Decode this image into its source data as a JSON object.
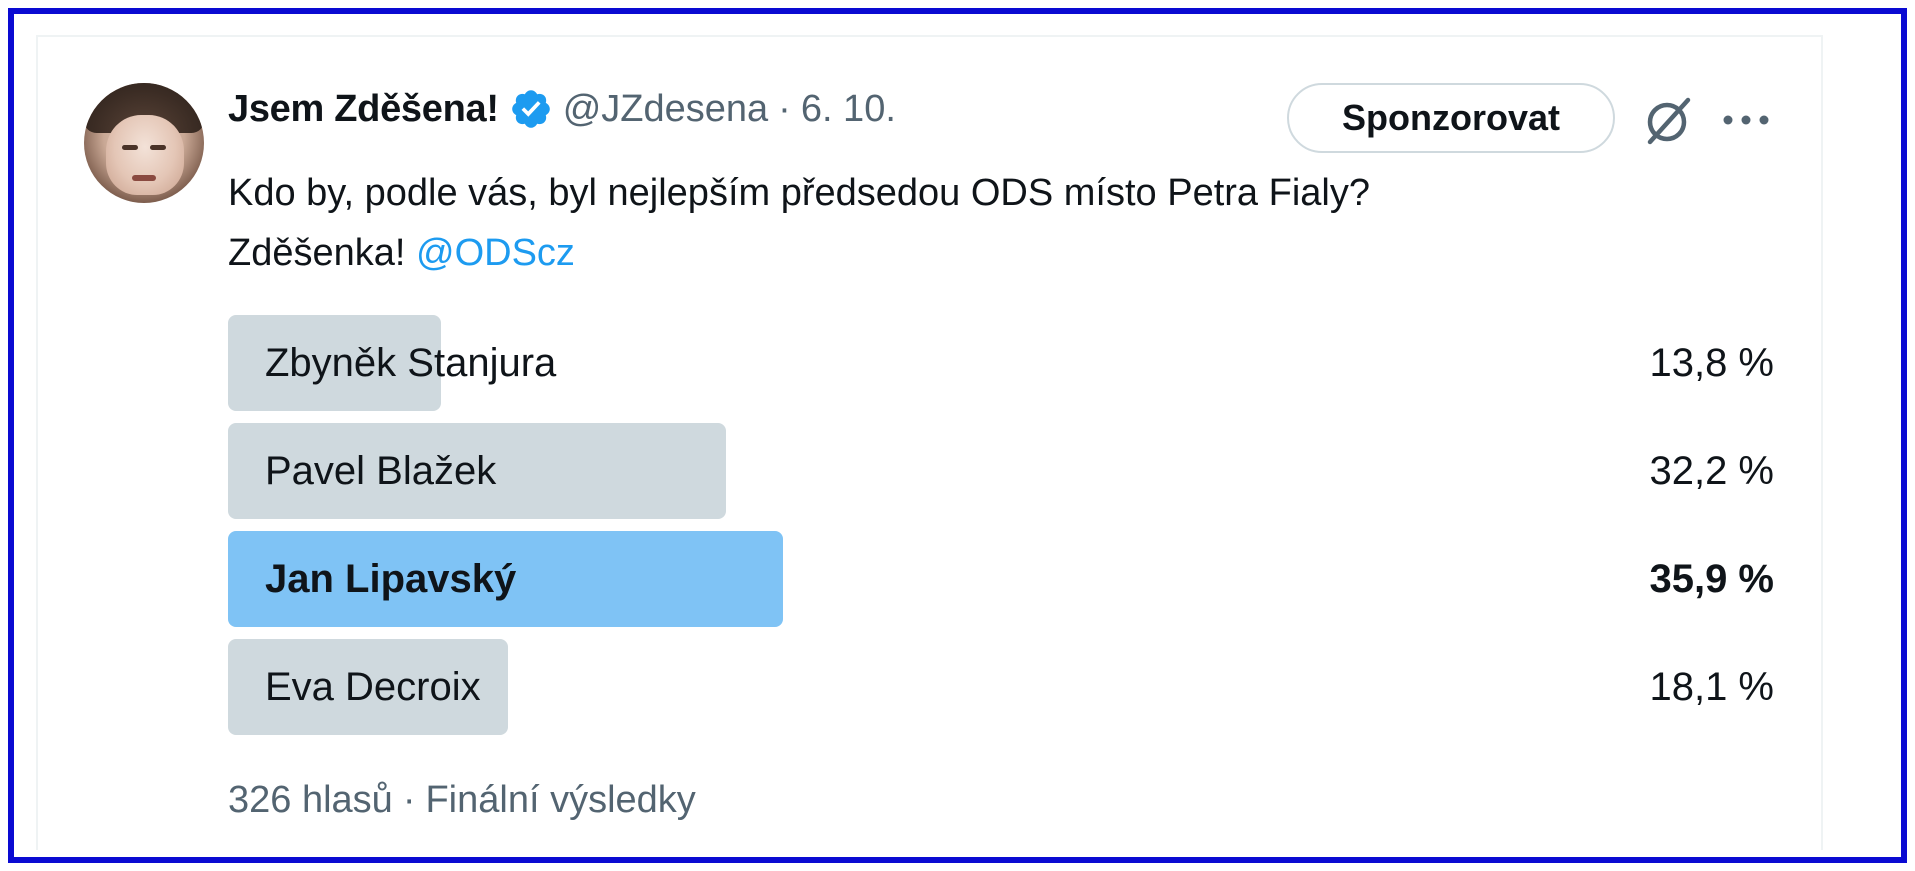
{
  "tweet": {
    "author": {
      "display_name": "Jsem Zděšena!",
      "verified": true,
      "handle": "@JZdesena",
      "date": "6. 10."
    },
    "text_line1": "Kdo by, podle vás, byl nejlepším předsedou ODS místo Petra Fialy?",
    "text_line2_prefix": "Zděšenka! ",
    "mention": "@ODScz"
  },
  "actions": {
    "sponsor_label": "Sponzorovat",
    "grok_icon": "grok-icon",
    "more_icon": "more-icon"
  },
  "poll": {
    "options": [
      {
        "label": "Zbyněk Stanjura",
        "value": "13,8 %",
        "fraction": 0.138,
        "winner": false
      },
      {
        "label": "Pavel Blažek",
        "value": "32,2 %",
        "fraction": 0.322,
        "winner": false
      },
      {
        "label": "Jan Lipavský",
        "value": "35,9 %",
        "fraction": 0.359,
        "winner": true
      },
      {
        "label": "Eva Decroix",
        "value": "18,1 %",
        "fraction": 0.181,
        "winner": false
      }
    ],
    "votes": "326 hlasů",
    "separator": "·",
    "status": "Finální výsledky"
  },
  "colors": {
    "text": "#0f1419",
    "muted": "#536471",
    "link": "#1d9bf0",
    "bar": "#cfd9de",
    "bar_winner": "#7fc3f5",
    "frame": "#0a0ad2"
  }
}
